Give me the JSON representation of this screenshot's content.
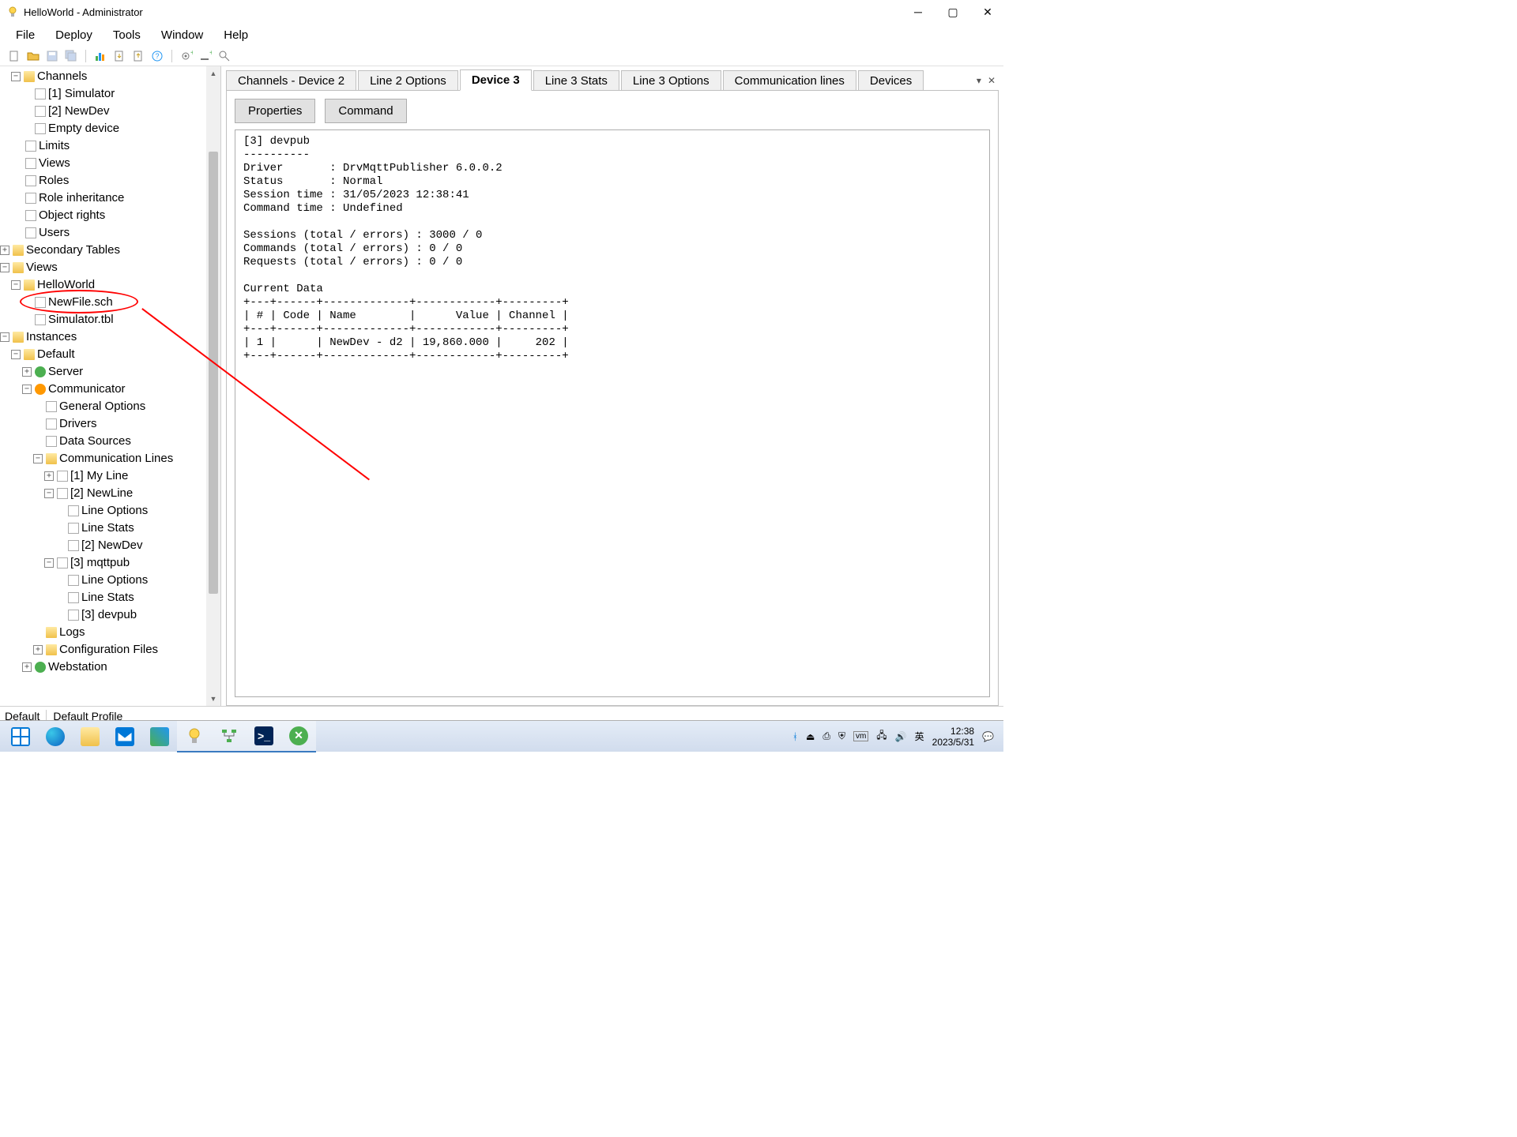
{
  "window": {
    "title": "HelloWorld - Administrator"
  },
  "menu": {
    "file": "File",
    "deploy": "Deploy",
    "tools": "Tools",
    "window": "Window",
    "help": "Help"
  },
  "tree": {
    "channels": "Channels",
    "sim": "[1] Simulator",
    "newdev": "[2] NewDev",
    "empty": "Empty device",
    "limits": "Limits",
    "views": "Views",
    "roles": "Roles",
    "roleinh": "Role inheritance",
    "objrights": "Object rights",
    "users": "Users",
    "sectables": "Secondary Tables",
    "views2": "Views",
    "helloworld": "HelloWorld",
    "newfile": "NewFile.sch",
    "simtbl": "Simulator.tbl",
    "instances": "Instances",
    "default": "Default",
    "server": "Server",
    "communicator": "Communicator",
    "genopts": "General Options",
    "drivers": "Drivers",
    "datasrc": "Data Sources",
    "commlines": "Communication Lines",
    "myline": "[1] My Line",
    "newline": "[2] NewLine",
    "lineopts": "Line Options",
    "linestats": "Line Stats",
    "newdev2": "[2] NewDev",
    "mqttpub": "[3] mqttpub",
    "lineopts2": "Line Options",
    "linestats2": "Line Stats",
    "devpub": "[3] devpub",
    "logs": "Logs",
    "cfgfiles": "Configuration Files",
    "webstation": "Webstation"
  },
  "tabs": {
    "t1": "Channels - Device 2",
    "t2": "Line 2 Options",
    "t3": "Device 3",
    "t4": "Line 3 Stats",
    "t5": "Line 3 Options",
    "t6": "Communication lines",
    "t7": "Devices"
  },
  "actions": {
    "properties": "Properties",
    "command": "Command"
  },
  "log_text": "[3] devpub\n----------\nDriver       : DrvMqttPublisher 6.0.0.2\nStatus       : Normal\nSession time : 31/05/2023 12:38:41\nCommand time : Undefined\n\nSessions (total / errors) : 3000 / 0\nCommands (total / errors) : 0 / 0\nRequests (total / errors) : 0 / 0\n\nCurrent Data\n+---+------+-------------+------------+---------+\n| # | Code | Name        |      Value | Channel |\n+---+------+-------------+------------+---------+\n| 1 |      | NewDev - d2 | 19,860.000 |     202 |\n+---+------+-------------+------------+---------+",
  "status": {
    "s1": "Default",
    "s2": "Default Profile"
  },
  "tray": {
    "ime": "英",
    "time": "12:38",
    "date": "2023/5/31"
  }
}
